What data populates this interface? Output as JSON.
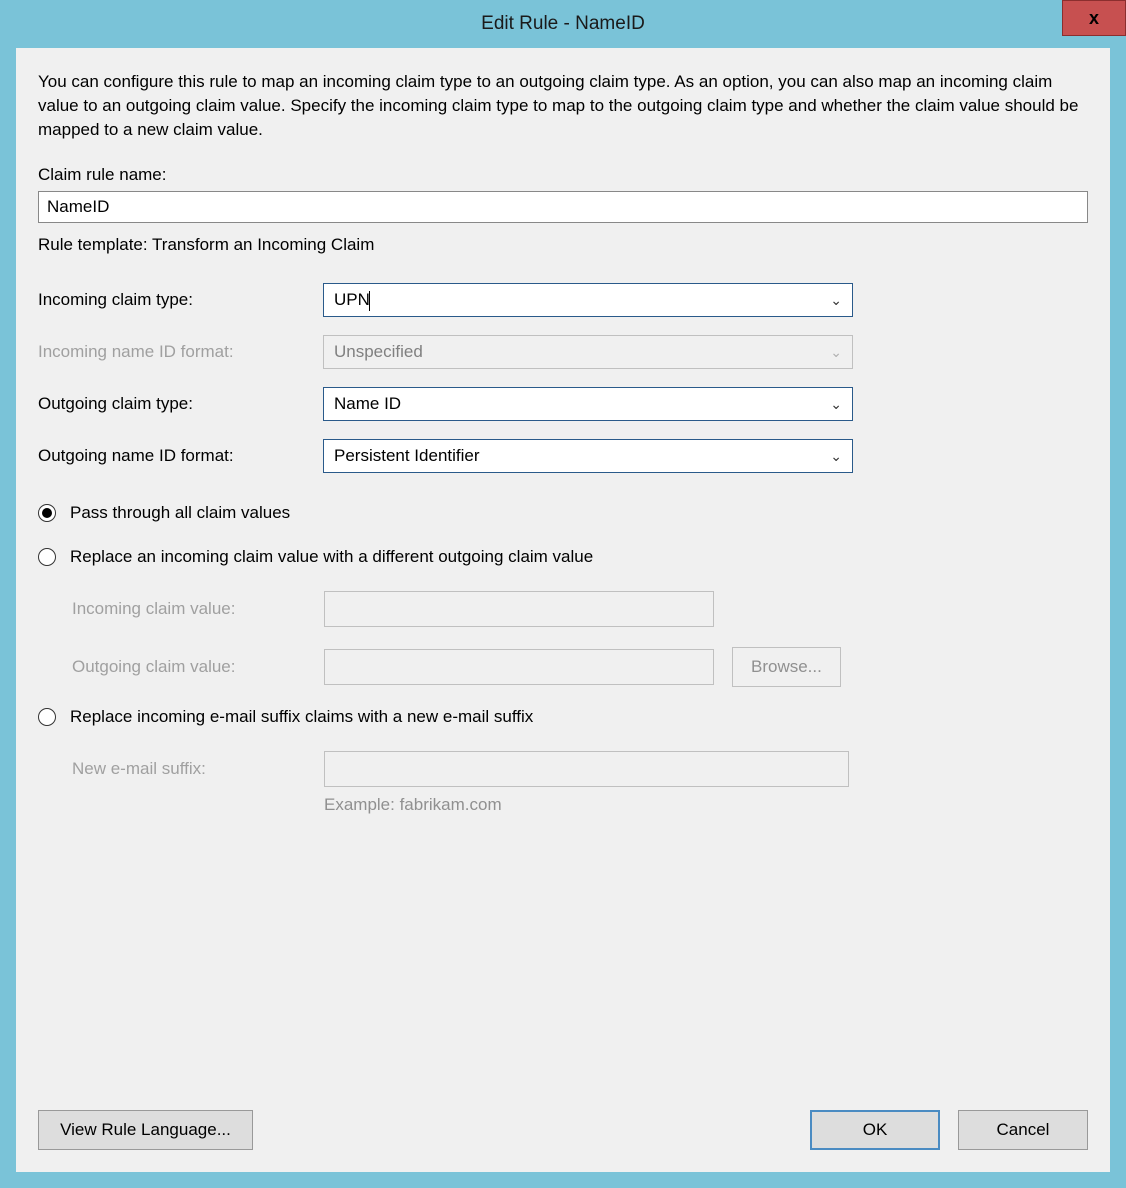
{
  "window": {
    "title": "Edit Rule - NameID",
    "close_label": "x"
  },
  "description": "You can configure this rule to map an incoming claim type to an outgoing claim type. As an option, you can also map an incoming claim value to an outgoing claim value. Specify the incoming claim type to map to the outgoing claim type and whether the claim value should be mapped to a new claim value.",
  "labels": {
    "claim_rule_name": "Claim rule name:",
    "rule_template_prefix": "Rule template: ",
    "rule_template_value": "Transform an Incoming Claim",
    "incoming_claim_type": "Incoming claim type:",
    "incoming_name_id_format": "Incoming name ID format:",
    "outgoing_claim_type": "Outgoing claim type:",
    "outgoing_name_id_format": "Outgoing name ID format:",
    "incoming_claim_value": "Incoming claim value:",
    "outgoing_claim_value": "Outgoing claim value:",
    "new_email_suffix": "New e-mail suffix:",
    "example": "Example: fabrikam.com"
  },
  "fields": {
    "claim_rule_name": "NameID",
    "incoming_claim_type": "UPN",
    "incoming_name_id_format": "Unspecified",
    "outgoing_claim_type": "Name ID",
    "outgoing_name_id_format": "Persistent Identifier"
  },
  "radios": {
    "pass_through": "Pass through all claim values",
    "replace_value": "Replace an incoming claim value with a different outgoing claim value",
    "replace_suffix": "Replace incoming e-mail suffix claims with a new e-mail suffix",
    "selected": "pass_through"
  },
  "buttons": {
    "browse": "Browse...",
    "view_rule_language": "View Rule Language...",
    "ok": "OK",
    "cancel": "Cancel"
  }
}
